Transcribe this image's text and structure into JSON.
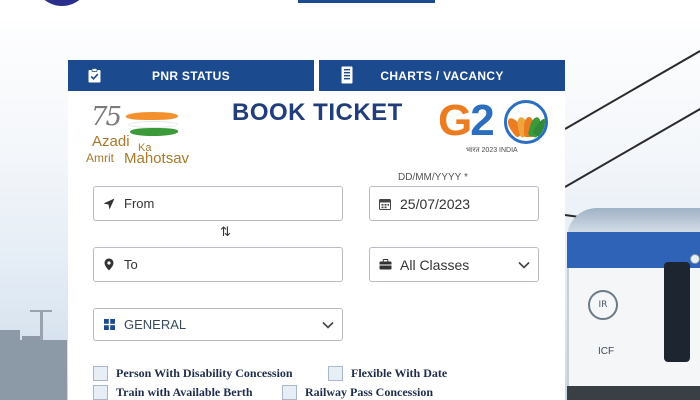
{
  "tabs": [
    {
      "label": "PNR STATUS",
      "icon": "clipboard-check-icon"
    },
    {
      "label": "CHARTS / VACANCY",
      "icon": "chart-document-icon"
    }
  ],
  "title": "BOOK TICKET",
  "azadi_logo": {
    "number": "75",
    "line1": "Azadi",
    "line2": "Ka",
    "line3": "Amrit",
    "line4": "Mahotsav"
  },
  "g20_logo": {
    "text": "G20",
    "subtitle": "भारत 2023 INDIA"
  },
  "form": {
    "from": {
      "placeholder": "From",
      "icon": "location-arrow-icon"
    },
    "swap_icon": "⇅",
    "to": {
      "placeholder": "To",
      "icon": "map-marker-icon"
    },
    "date": {
      "label": "DD/MM/YYYY *",
      "value": "25/07/2023",
      "icon": "calendar-icon"
    },
    "class": {
      "value": "All Classes",
      "icon": "briefcase-icon"
    },
    "quota": {
      "value": "GENERAL",
      "icon": "grid-icon"
    }
  },
  "checkboxes": [
    {
      "label": "Person With Disability Concession",
      "checked": false
    },
    {
      "label": "Flexible With Date",
      "checked": false
    },
    {
      "label": "Train with Available Berth",
      "checked": false
    },
    {
      "label": "Railway Pass Concession",
      "checked": false
    }
  ],
  "train": {
    "logo": "IR",
    "marking": "ICF"
  },
  "colors": {
    "primary": "#1c4a8e",
    "title": "#213d7a",
    "field_border": "#b8bdc4"
  }
}
